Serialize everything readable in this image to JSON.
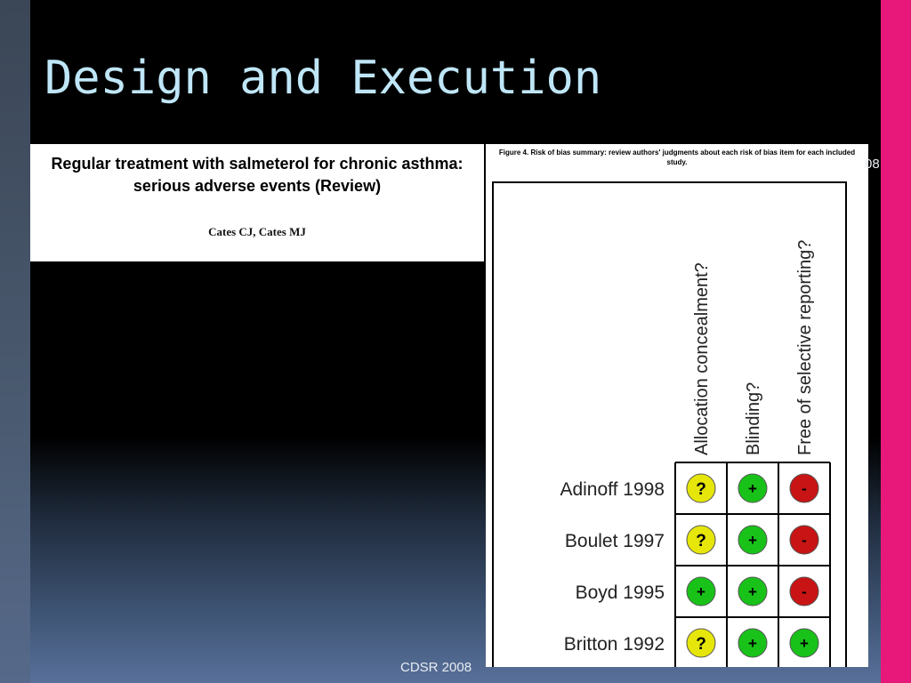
{
  "slide": {
    "title": "Design and Execution",
    "footer": "CDSR 2008",
    "slide_number_fragment": "08"
  },
  "review": {
    "title": "Regular treatment with salmeterol for chronic asthma: serious adverse events (Review)",
    "authors": "Cates CJ, Cates MJ"
  },
  "figure": {
    "caption": "Figure 4. Risk of bias summary: review authors' judgments about each risk of bias item for each included study.",
    "columns": [
      "Allocation concealment?",
      "Blinding?",
      "Free of selective reporting?"
    ],
    "rows": [
      {
        "study": "Adinoff 1998",
        "judgments": [
          "?",
          "+",
          "-"
        ]
      },
      {
        "study": "Boulet 1997",
        "judgments": [
          "?",
          "+",
          "-"
        ]
      },
      {
        "study": "Boyd 1995",
        "judgments": [
          "+",
          "+",
          "-"
        ]
      },
      {
        "study": "Britton 1992",
        "judgments": [
          "?",
          "+",
          "+"
        ]
      }
    ],
    "colors": {
      "unclear": "#e6e60a",
      "low_risk": "#19c219",
      "high_risk": "#c81414"
    }
  }
}
